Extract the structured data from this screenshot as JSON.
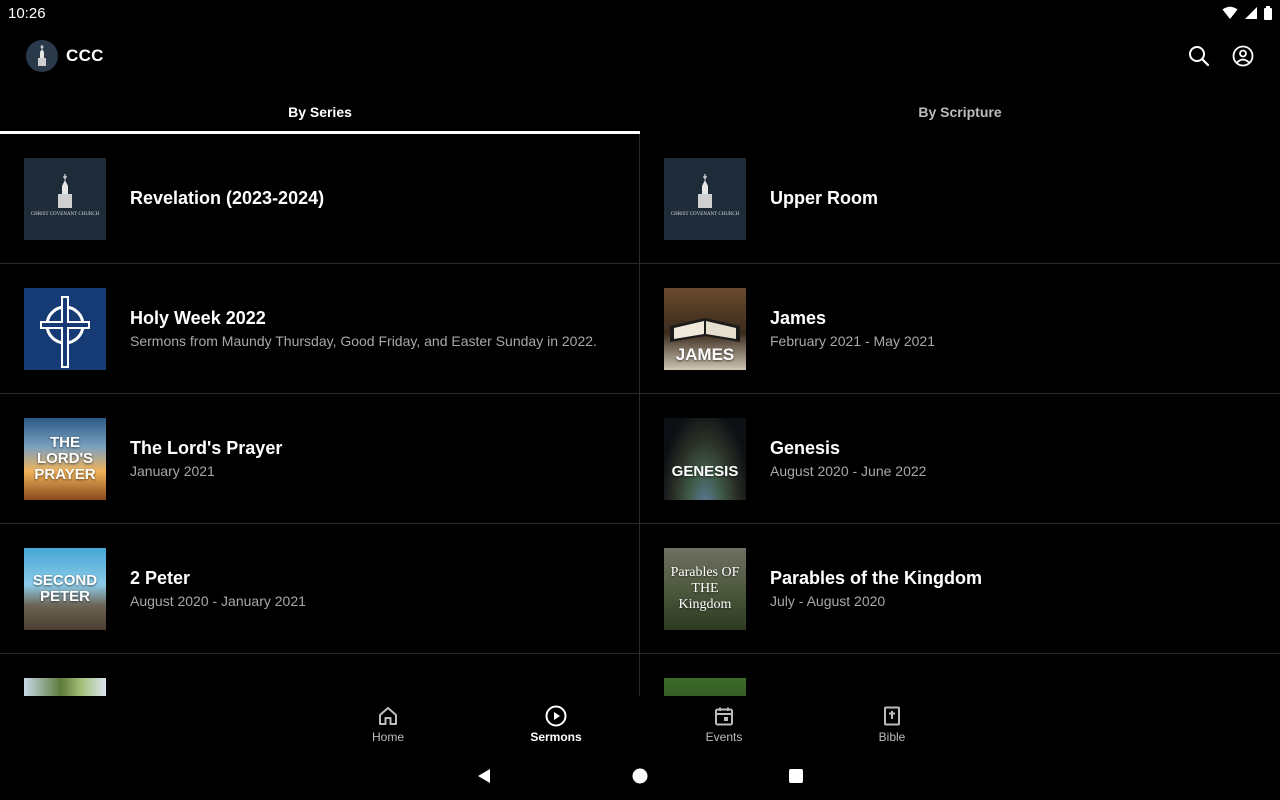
{
  "status": {
    "time": "10:26"
  },
  "app": {
    "title": "CCC"
  },
  "tabs": [
    {
      "label": "By Series",
      "active": true
    },
    {
      "label": "By Scripture",
      "active": false
    }
  ],
  "series": [
    {
      "title": "Revelation (2023-2024)",
      "subtitle": "",
      "thumb": {
        "style": "logo",
        "text": "CHRIST COVENANT CHURCH"
      }
    },
    {
      "title": "Upper Room",
      "subtitle": "",
      "thumb": {
        "style": "logo",
        "text": "CHRIST COVENANT CHURCH"
      }
    },
    {
      "title": "Holy Week 2022",
      "subtitle": "Sermons from Maundy Thursday, Good Friday, and Easter Sunday in 2022.",
      "thumb": {
        "style": "cross",
        "text": ""
      }
    },
    {
      "title": "James",
      "subtitle": "February 2021 - May 2021",
      "thumb": {
        "style": "james",
        "text": "JAMES"
      }
    },
    {
      "title": "The Lord's Prayer",
      "subtitle": "January 2021",
      "thumb": {
        "style": "sunset",
        "text": "THE LORD'S PRAYER"
      }
    },
    {
      "title": "Genesis",
      "subtitle": "August 2020 - June 2022",
      "thumb": {
        "style": "earth",
        "text": "GENESIS"
      }
    },
    {
      "title": "2 Peter",
      "subtitle": "August 2020 - January 2021",
      "thumb": {
        "style": "mountain",
        "text": "SECOND PETER"
      }
    },
    {
      "title": "Parables of the Kingdom",
      "subtitle": "July - August 2020",
      "thumb": {
        "style": "wheat",
        "text": "Parables OF THE Kingdom"
      }
    },
    {
      "title": "",
      "subtitle": "",
      "thumb": {
        "style": "partial-sky",
        "text": ""
      }
    },
    {
      "title": "",
      "subtitle": "",
      "thumb": {
        "style": "partial-fruit",
        "text": ""
      }
    }
  ],
  "bottom_nav": [
    {
      "label": "Home",
      "icon": "home-icon",
      "active": false
    },
    {
      "label": "Sermons",
      "icon": "play-circle-icon",
      "active": true
    },
    {
      "label": "Events",
      "icon": "calendar-icon",
      "active": false
    },
    {
      "label": "Bible",
      "icon": "bible-icon",
      "active": false
    }
  ]
}
